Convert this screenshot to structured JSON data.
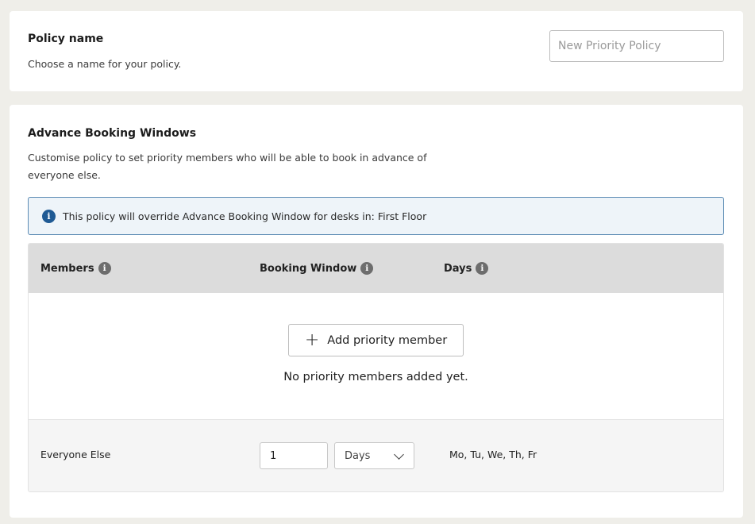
{
  "policy_card": {
    "title": "Policy name",
    "description": "Choose a name for your policy.",
    "name_input": {
      "value": "",
      "placeholder": "New Priority Policy"
    }
  },
  "abw_card": {
    "title": "Advance Booking Windows",
    "description": "Customise policy to set priority members who will be able to book in advance of everyone else.",
    "banner": {
      "icon": "info-icon",
      "text": "This policy will override Advance Booking Window for desks in: First Floor"
    },
    "table": {
      "headers": [
        {
          "label": "Members",
          "icon": "info-icon"
        },
        {
          "label": "Booking Window",
          "icon": "info-icon"
        },
        {
          "label": "Days",
          "icon": "info-icon"
        }
      ],
      "add_button": {
        "icon": "plus-icon",
        "label": "Add priority member"
      },
      "empty_message": "No priority members added yet.",
      "everyone_else": {
        "label": "Everyone Else",
        "window_value": "1",
        "unit": "Days",
        "days": "Mo, Tu, We, Th, Fr"
      }
    }
  },
  "colors": {
    "page_bg": "#efeee9",
    "banner_border": "#5b8bb4",
    "banner_bg": "#eef4f9",
    "info_icon": "#1f5a94",
    "table_header_bg": "#dcdcdc"
  }
}
